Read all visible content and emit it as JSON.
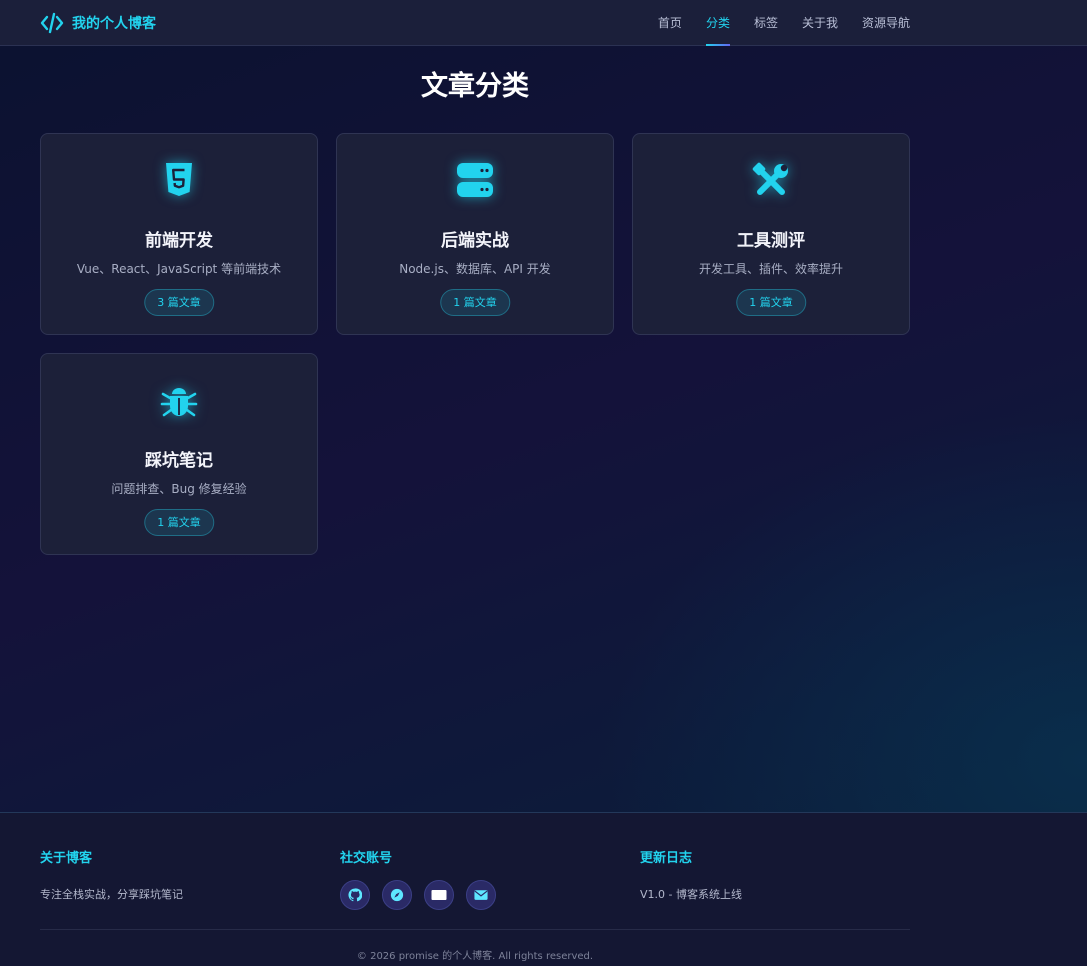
{
  "header": {
    "brand_name": "我的个人博客",
    "nav": [
      {
        "label": "首页",
        "active": false
      },
      {
        "label": "分类",
        "active": true
      },
      {
        "label": "标签",
        "active": false
      },
      {
        "label": "关于我",
        "active": false
      },
      {
        "label": "资源导航",
        "active": false
      }
    ]
  },
  "main": {
    "title": "文章分类",
    "categories": [
      {
        "icon": "html5-icon",
        "title": "前端开发",
        "desc": "Vue、React、JavaScript 等前端技术",
        "badge": "3 篇文章"
      },
      {
        "icon": "server-icon",
        "title": "后端实战",
        "desc": "Node.js、数据库、API 开发",
        "badge": "1 篇文章"
      },
      {
        "icon": "tools-icon",
        "title": "工具测评",
        "desc": "开发工具、插件、效率提升",
        "badge": "1 篇文章"
      },
      {
        "icon": "bug-icon",
        "title": "踩坑笔记",
        "desc": "问题排查、Bug 修复经验",
        "badge": "1 篇文章"
      }
    ]
  },
  "footer": {
    "about": {
      "heading": "关于博客",
      "text": "专注全栈实战，分享踩坑笔记"
    },
    "social": {
      "heading": "社交账号",
      "icons": [
        "github-icon",
        "compass-icon",
        "card-icon",
        "mail-icon"
      ]
    },
    "changelog": {
      "heading": "更新日志",
      "text": "V1.0 - 博客系统上线"
    },
    "copyright": "© 2026 promise 的个人博客. All rights reserved."
  },
  "colors": {
    "accent": "#22d3ee",
    "card_bg": "#1c2039",
    "header_bg": "#1b1f3a"
  }
}
